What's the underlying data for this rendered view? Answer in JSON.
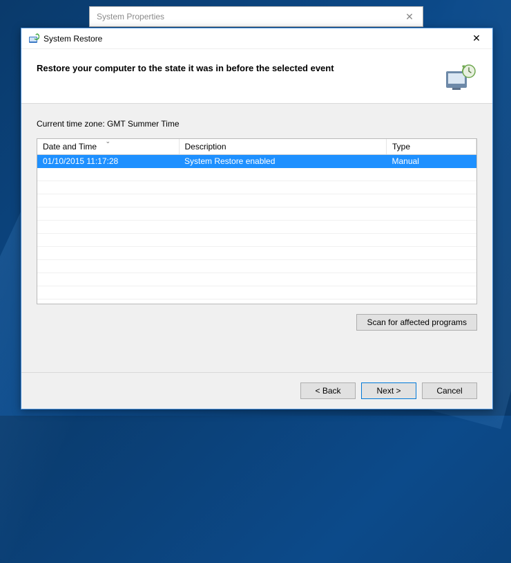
{
  "background_window": {
    "title": "System Properties"
  },
  "dialog": {
    "title": "System Restore",
    "heading": "Restore your computer to the state it was in before the selected event",
    "timezone_label": "Current time zone: GMT Summer Time",
    "columns": {
      "date": "Date and Time",
      "description": "Description",
      "type": "Type"
    },
    "rows": [
      {
        "date": "01/10/2015 11:17:28",
        "description": "System Restore enabled",
        "type": "Manual",
        "selected": true
      }
    ],
    "scan_button": "Scan for affected programs",
    "buttons": {
      "back": "< Back",
      "next": "Next >",
      "cancel": "Cancel"
    }
  }
}
